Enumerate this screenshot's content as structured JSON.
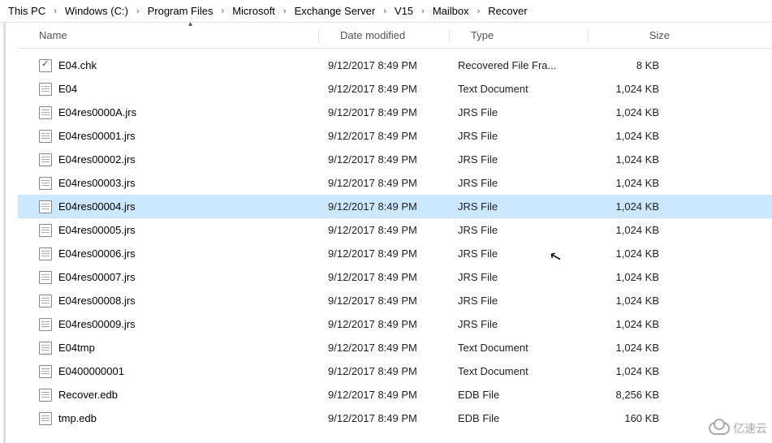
{
  "breadcrumb": [
    "This PC",
    "Windows (C:)",
    "Program Files",
    "Microsoft",
    "Exchange Server",
    "V15",
    "Mailbox",
    "Recover"
  ],
  "columns": {
    "name": "Name",
    "date": "Date modified",
    "type": "Type",
    "size": "Size"
  },
  "files": [
    {
      "name": "E04.chk",
      "date": "9/12/2017 8:49 PM",
      "type": "Recovered File Fra...",
      "size": "8 KB",
      "icon": "chk",
      "selected": false
    },
    {
      "name": "E04",
      "date": "9/12/2017 8:49 PM",
      "type": "Text Document",
      "size": "1,024 KB",
      "icon": "doc",
      "selected": false
    },
    {
      "name": "E04res0000A.jrs",
      "date": "9/12/2017 8:49 PM",
      "type": "JRS File",
      "size": "1,024 KB",
      "icon": "doc",
      "selected": false
    },
    {
      "name": "E04res00001.jrs",
      "date": "9/12/2017 8:49 PM",
      "type": "JRS File",
      "size": "1,024 KB",
      "icon": "doc",
      "selected": false
    },
    {
      "name": "E04res00002.jrs",
      "date": "9/12/2017 8:49 PM",
      "type": "JRS File",
      "size": "1,024 KB",
      "icon": "doc",
      "selected": false
    },
    {
      "name": "E04res00003.jrs",
      "date": "9/12/2017 8:49 PM",
      "type": "JRS File",
      "size": "1,024 KB",
      "icon": "doc",
      "selected": false
    },
    {
      "name": "E04res00004.jrs",
      "date": "9/12/2017 8:49 PM",
      "type": "JRS File",
      "size": "1,024 KB",
      "icon": "doc",
      "selected": true
    },
    {
      "name": "E04res00005.jrs",
      "date": "9/12/2017 8:49 PM",
      "type": "JRS File",
      "size": "1,024 KB",
      "icon": "doc",
      "selected": false
    },
    {
      "name": "E04res00006.jrs",
      "date": "9/12/2017 8:49 PM",
      "type": "JRS File",
      "size": "1,024 KB",
      "icon": "doc",
      "selected": false
    },
    {
      "name": "E04res00007.jrs",
      "date": "9/12/2017 8:49 PM",
      "type": "JRS File",
      "size": "1,024 KB",
      "icon": "doc",
      "selected": false
    },
    {
      "name": "E04res00008.jrs",
      "date": "9/12/2017 8:49 PM",
      "type": "JRS File",
      "size": "1,024 KB",
      "icon": "doc",
      "selected": false
    },
    {
      "name": "E04res00009.jrs",
      "date": "9/12/2017 8:49 PM",
      "type": "JRS File",
      "size": "1,024 KB",
      "icon": "doc",
      "selected": false
    },
    {
      "name": "E04tmp",
      "date": "9/12/2017 8:49 PM",
      "type": "Text Document",
      "size": "1,024 KB",
      "icon": "doc",
      "selected": false
    },
    {
      "name": "E0400000001",
      "date": "9/12/2017 8:49 PM",
      "type": "Text Document",
      "size": "1,024 KB",
      "icon": "doc",
      "selected": false
    },
    {
      "name": "Recover.edb",
      "date": "9/12/2017 8:49 PM",
      "type": "EDB File",
      "size": "8,256 KB",
      "icon": "doc",
      "selected": false
    },
    {
      "name": "tmp.edb",
      "date": "9/12/2017 8:49 PM",
      "type": "EDB File",
      "size": "160 KB",
      "icon": "doc",
      "selected": false
    }
  ],
  "watermark": "亿速云"
}
